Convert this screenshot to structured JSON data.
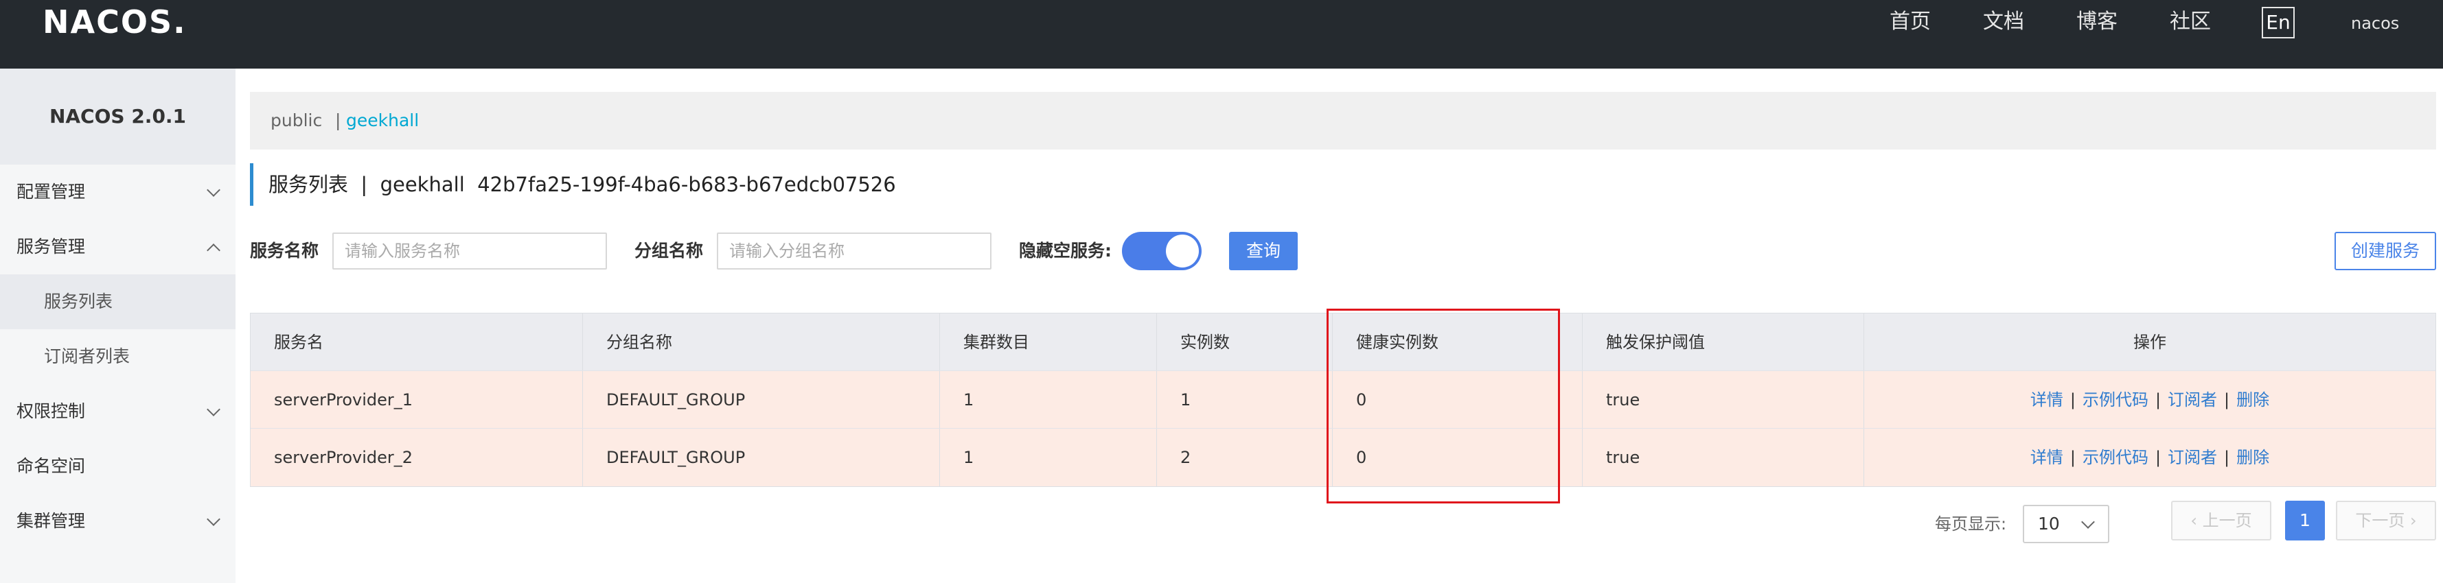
{
  "header": {
    "logo": "NACOS.",
    "nav": [
      "首页",
      "文档",
      "博客",
      "社区"
    ],
    "lang": "En",
    "user": "nacos"
  },
  "sidebar": {
    "title": "NACOS 2.0.1",
    "items": [
      {
        "label": "配置管理"
      },
      {
        "label": "服务管理"
      },
      {
        "label": "服务列表"
      },
      {
        "label": "订阅者列表"
      },
      {
        "label": "权限控制"
      },
      {
        "label": "命名空间"
      },
      {
        "label": "集群管理"
      }
    ]
  },
  "namespace": {
    "public": "public",
    "separator": "|",
    "current": "geekhall"
  },
  "page": {
    "title": "服务列表  |  geekhall  42b7fa25-199f-4ba6-b683-b67edcb07526"
  },
  "filters": {
    "service_name_label": "服务名称",
    "service_name_placeholder": "请输入服务名称",
    "group_name_label": "分组名称",
    "group_name_placeholder": "请输入分组名称",
    "hide_empty_label": "隐藏空服务:",
    "hide_empty_on": true,
    "query_label": "查询",
    "create_label": "创建服务"
  },
  "table": {
    "columns": [
      "服务名",
      "分组名称",
      "集群数目",
      "实例数",
      "健康实例数",
      "触发保护阈值",
      "操作"
    ],
    "rows": [
      {
        "service": "serverProvider_1",
        "group": "DEFAULT_GROUP",
        "clusters": "1",
        "instances": "1",
        "healthy": "0",
        "threshold": "true"
      },
      {
        "service": "serverProvider_2",
        "group": "DEFAULT_GROUP",
        "clusters": "1",
        "instances": "2",
        "healthy": "0",
        "threshold": "true"
      }
    ],
    "ops": {
      "detail": "详情",
      "sample": "示例代码",
      "subscriber": "订阅者",
      "delete": "删除",
      "sep": "|"
    }
  },
  "pagination": {
    "per_page_label": "每页显示:",
    "per_page_value": "10",
    "prev": "‹ 上一页",
    "current": "1",
    "next": "下一页 ›"
  },
  "colors": {
    "topbar": "#252a2f",
    "accent": "#4a84e8",
    "link": "#2f7ccf",
    "row_highlight": "#fdebe4",
    "annotation_box": "#e0161c"
  }
}
